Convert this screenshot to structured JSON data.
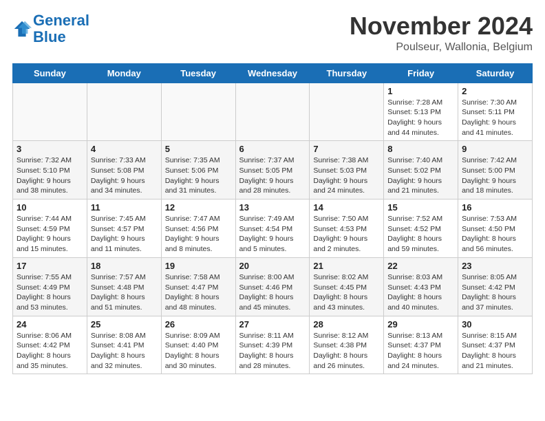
{
  "logo": {
    "line1": "General",
    "line2": "Blue"
  },
  "title": "November 2024",
  "location": "Poulseur, Wallonia, Belgium",
  "days_of_week": [
    "Sunday",
    "Monday",
    "Tuesday",
    "Wednesday",
    "Thursday",
    "Friday",
    "Saturday"
  ],
  "weeks": [
    [
      {
        "day": "",
        "info": ""
      },
      {
        "day": "",
        "info": ""
      },
      {
        "day": "",
        "info": ""
      },
      {
        "day": "",
        "info": ""
      },
      {
        "day": "",
        "info": ""
      },
      {
        "day": "1",
        "info": "Sunrise: 7:28 AM\nSunset: 5:13 PM\nDaylight: 9 hours and 44 minutes."
      },
      {
        "day": "2",
        "info": "Sunrise: 7:30 AM\nSunset: 5:11 PM\nDaylight: 9 hours and 41 minutes."
      }
    ],
    [
      {
        "day": "3",
        "info": "Sunrise: 7:32 AM\nSunset: 5:10 PM\nDaylight: 9 hours and 38 minutes."
      },
      {
        "day": "4",
        "info": "Sunrise: 7:33 AM\nSunset: 5:08 PM\nDaylight: 9 hours and 34 minutes."
      },
      {
        "day": "5",
        "info": "Sunrise: 7:35 AM\nSunset: 5:06 PM\nDaylight: 9 hours and 31 minutes."
      },
      {
        "day": "6",
        "info": "Sunrise: 7:37 AM\nSunset: 5:05 PM\nDaylight: 9 hours and 28 minutes."
      },
      {
        "day": "7",
        "info": "Sunrise: 7:38 AM\nSunset: 5:03 PM\nDaylight: 9 hours and 24 minutes."
      },
      {
        "day": "8",
        "info": "Sunrise: 7:40 AM\nSunset: 5:02 PM\nDaylight: 9 hours and 21 minutes."
      },
      {
        "day": "9",
        "info": "Sunrise: 7:42 AM\nSunset: 5:00 PM\nDaylight: 9 hours and 18 minutes."
      }
    ],
    [
      {
        "day": "10",
        "info": "Sunrise: 7:44 AM\nSunset: 4:59 PM\nDaylight: 9 hours and 15 minutes."
      },
      {
        "day": "11",
        "info": "Sunrise: 7:45 AM\nSunset: 4:57 PM\nDaylight: 9 hours and 11 minutes."
      },
      {
        "day": "12",
        "info": "Sunrise: 7:47 AM\nSunset: 4:56 PM\nDaylight: 9 hours and 8 minutes."
      },
      {
        "day": "13",
        "info": "Sunrise: 7:49 AM\nSunset: 4:54 PM\nDaylight: 9 hours and 5 minutes."
      },
      {
        "day": "14",
        "info": "Sunrise: 7:50 AM\nSunset: 4:53 PM\nDaylight: 9 hours and 2 minutes."
      },
      {
        "day": "15",
        "info": "Sunrise: 7:52 AM\nSunset: 4:52 PM\nDaylight: 8 hours and 59 minutes."
      },
      {
        "day": "16",
        "info": "Sunrise: 7:53 AM\nSunset: 4:50 PM\nDaylight: 8 hours and 56 minutes."
      }
    ],
    [
      {
        "day": "17",
        "info": "Sunrise: 7:55 AM\nSunset: 4:49 PM\nDaylight: 8 hours and 53 minutes."
      },
      {
        "day": "18",
        "info": "Sunrise: 7:57 AM\nSunset: 4:48 PM\nDaylight: 8 hours and 51 minutes."
      },
      {
        "day": "19",
        "info": "Sunrise: 7:58 AM\nSunset: 4:47 PM\nDaylight: 8 hours and 48 minutes."
      },
      {
        "day": "20",
        "info": "Sunrise: 8:00 AM\nSunset: 4:46 PM\nDaylight: 8 hours and 45 minutes."
      },
      {
        "day": "21",
        "info": "Sunrise: 8:02 AM\nSunset: 4:45 PM\nDaylight: 8 hours and 43 minutes."
      },
      {
        "day": "22",
        "info": "Sunrise: 8:03 AM\nSunset: 4:43 PM\nDaylight: 8 hours and 40 minutes."
      },
      {
        "day": "23",
        "info": "Sunrise: 8:05 AM\nSunset: 4:42 PM\nDaylight: 8 hours and 37 minutes."
      }
    ],
    [
      {
        "day": "24",
        "info": "Sunrise: 8:06 AM\nSunset: 4:42 PM\nDaylight: 8 hours and 35 minutes."
      },
      {
        "day": "25",
        "info": "Sunrise: 8:08 AM\nSunset: 4:41 PM\nDaylight: 8 hours and 32 minutes."
      },
      {
        "day": "26",
        "info": "Sunrise: 8:09 AM\nSunset: 4:40 PM\nDaylight: 8 hours and 30 minutes."
      },
      {
        "day": "27",
        "info": "Sunrise: 8:11 AM\nSunset: 4:39 PM\nDaylight: 8 hours and 28 minutes."
      },
      {
        "day": "28",
        "info": "Sunrise: 8:12 AM\nSunset: 4:38 PM\nDaylight: 8 hours and 26 minutes."
      },
      {
        "day": "29",
        "info": "Sunrise: 8:13 AM\nSunset: 4:37 PM\nDaylight: 8 hours and 24 minutes."
      },
      {
        "day": "30",
        "info": "Sunrise: 8:15 AM\nSunset: 4:37 PM\nDaylight: 8 hours and 21 minutes."
      }
    ]
  ]
}
